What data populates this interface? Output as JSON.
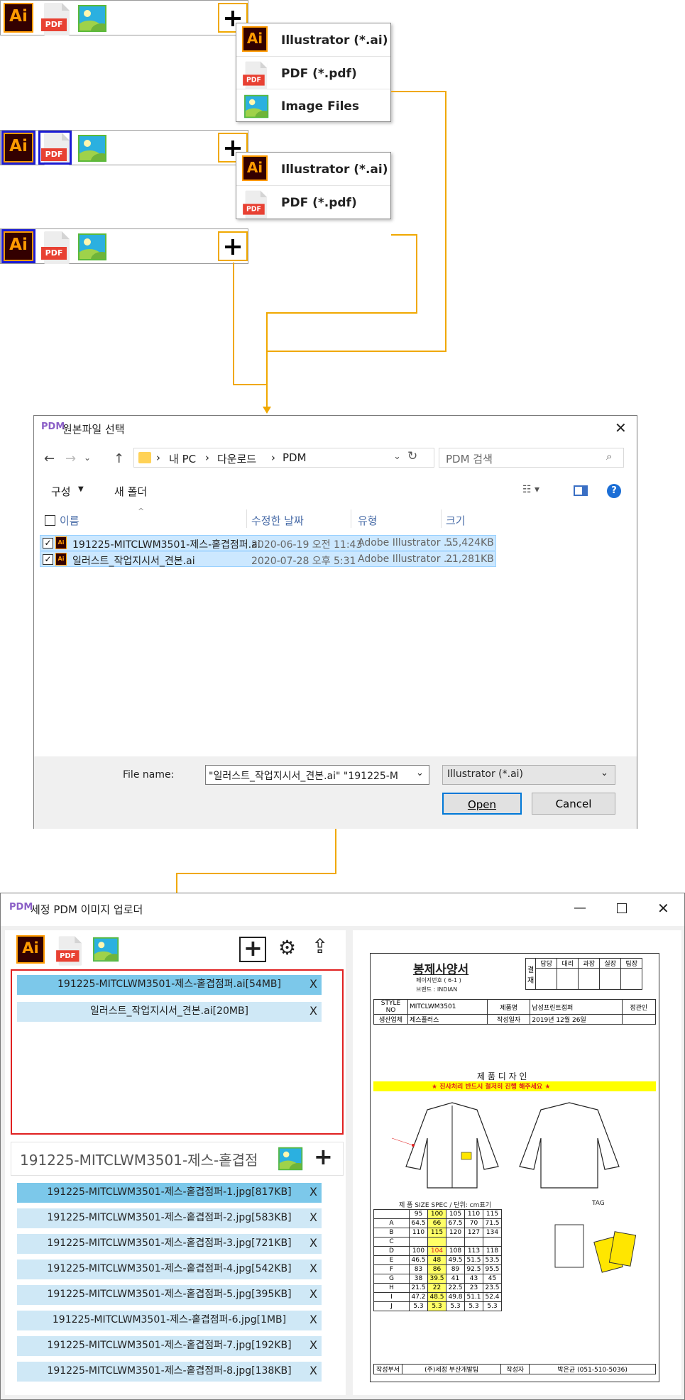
{
  "menu1": {
    "items": [
      {
        "icon": "ai-icon",
        "label": "Illustrator (*.ai)"
      },
      {
        "icon": "pdf-icon",
        "label": "PDF (*.pdf)"
      },
      {
        "icon": "image-icon",
        "label": "Image Files"
      }
    ]
  },
  "menu2": {
    "items": [
      {
        "icon": "ai-icon",
        "label": "Illustrator (*.ai)"
      },
      {
        "icon": "pdf-icon",
        "label": "PDF (*.pdf)"
      }
    ]
  },
  "icons": {
    "ai": "Ai",
    "pdf": "PDF"
  },
  "dialog": {
    "title": "원본파일 선택",
    "title_icon": "PDM",
    "breadcrumb": [
      "내 PC",
      "다운로드",
      "PDM"
    ],
    "search_placeholder": "PDM 검색",
    "organize": "구성",
    "new_folder": "새 폴더",
    "columns": [
      "이름",
      "수정한 날짜",
      "유형",
      "크기"
    ],
    "files": [
      {
        "name": "191225-MITCLWM3501-제스-홑겹점퍼.ai",
        "date": "2020-06-19 오전 11:43",
        "type": "Adobe Illustrator ...",
        "size": "55,424KB"
      },
      {
        "name": "일러스트_작업지시서_견본.ai",
        "date": "2020-07-28 오후 5:31",
        "type": "Adobe Illustrator ...",
        "size": "21,281KB"
      }
    ],
    "filename_label": "File name:",
    "filename_value": "\"일러스트_작업지시서_견본.ai\" \"191225-M",
    "filetype": "Illustrator (*.ai)",
    "open": "Open",
    "cancel": "Cancel"
  },
  "uploader": {
    "title": "세정 PDM 이미지 업로더",
    "title_icon": "PDM",
    "selected_files": [
      "191225-MITCLWM3501-제스-홑겹점퍼.ai[54MB]",
      "일러스트_작업지시서_견본.ai[20MB]"
    ],
    "current_file": "191225-MITCLWM3501-제스-홑겹점",
    "images": [
      "191225-MITCLWM3501-제스-홑겹점퍼-1.jpg[817KB]",
      "191225-MITCLWM3501-제스-홑겹점퍼-2.jpg[583KB]",
      "191225-MITCLWM3501-제스-홑겹점퍼-3.jpg[721KB]",
      "191225-MITCLWM3501-제스-홑겹점퍼-4.jpg[542KB]",
      "191225-MITCLWM3501-제스-홑겹점퍼-5.jpg[395KB]",
      "191225-MITCLWM3501-제스-홑겹점퍼-6.jpg[1MB]",
      "191225-MITCLWM3501-제스-홑겹점퍼-7.jpg[192KB]",
      "191225-MITCLWM3501-제스-홑겹점퍼-8.jpg[138KB]"
    ],
    "remove": "X"
  },
  "sheet": {
    "title": "봉제사양서",
    "approvals": [
      "결재",
      "담당",
      "대리",
      "과장",
      "실장",
      "팀장"
    ],
    "page_no": "페이지번호 ( 6-1 )",
    "brand": "브랜드 : INDIAN",
    "style_no": "MITCLWM3501",
    "product": "남성프린트점퍼",
    "manager": "정관인",
    "maker": "제스플러스",
    "date": "2019년 12월 26일",
    "section_design": "제 품 디 자 인",
    "warning": "★ 진사처리 반드시 철저히 진행 해주세요 ★",
    "spec_title": "제 품 SIZE SPEC / 단위: cm표기",
    "tag_title": "TAG",
    "sizes": [
      "95",
      "100",
      "105",
      "110",
      "115"
    ],
    "footer_left": "(주)세정 부산개발팀",
    "footer_right": "박은균 (051-510-5036)"
  },
  "colors": {
    "accent": "#f0a800",
    "selection": "#1c1cd4",
    "list_item": "#cfe8f6",
    "list_selected": "#7cc8ea",
    "highlight_red": "#e02020"
  }
}
